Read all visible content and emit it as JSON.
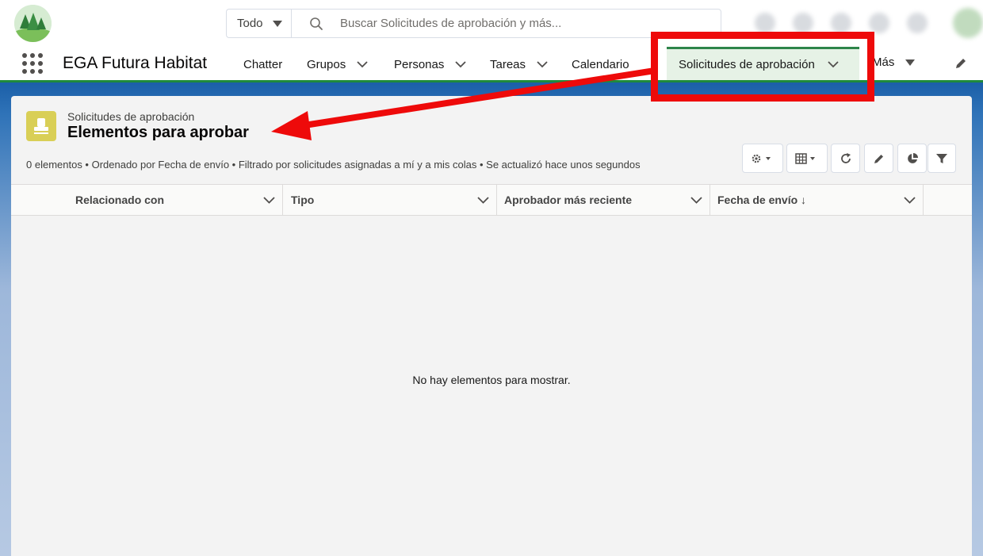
{
  "header": {
    "search_scope": "Todo",
    "search_placeholder": "Buscar Solicitudes de aprobación y más..."
  },
  "nav": {
    "app_name": "EGA Futura Habitat",
    "items": [
      {
        "label": "Chatter"
      },
      {
        "label": "Grupos"
      },
      {
        "label": "Personas"
      },
      {
        "label": "Tareas"
      },
      {
        "label": "Calendario"
      }
    ],
    "active_item": "Solicitudes de aprobación",
    "more": "Más"
  },
  "list_view": {
    "object_label": "Solicitudes de aprobación",
    "title": "Elementos para aprobar",
    "meta": "0 elementos • Ordenado por Fecha de envío • Filtrado por solicitudes asignadas a mí y a mis colas • Se actualizó hace unos segundos",
    "columns": [
      {
        "label": "Relacionado con"
      },
      {
        "label": "Tipo"
      },
      {
        "label": "Aprobador más reciente"
      },
      {
        "label": "Fecha de envío ↓"
      }
    ],
    "empty_message": "No hay elementos para mostrar."
  },
  "colors": {
    "nav_accent": "#2e844a",
    "active_tab_bg": "#e6f2e6",
    "object_icon": "#d9cf56",
    "annotation_red": "#ee0a0a"
  },
  "icons": [
    "app-launcher-icon",
    "search-icon",
    "settings-icon",
    "display-as-table-icon",
    "refresh-icon",
    "edit-icon",
    "chart-icon",
    "filter-icon"
  ]
}
